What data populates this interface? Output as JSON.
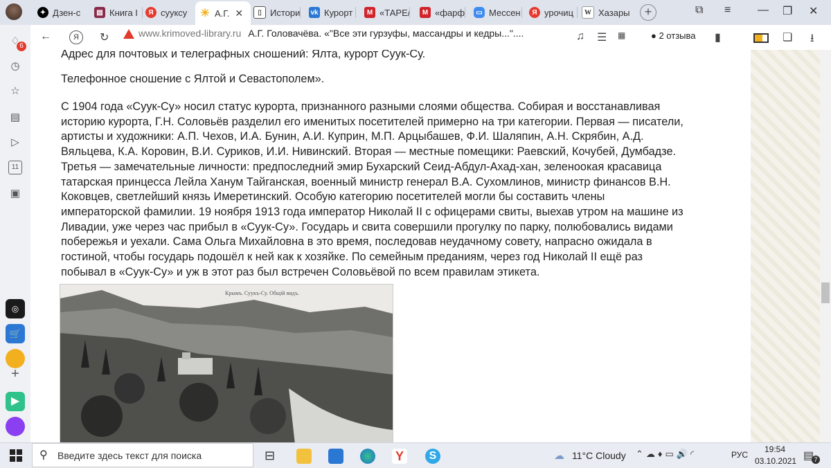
{
  "tabs": [
    {
      "label": "Дзен-с",
      "color": "#000"
    },
    {
      "label": "Книга I",
      "color": "#8a2a4a"
    },
    {
      "label": "суукcу",
      "color": "#e63a2e"
    },
    {
      "label": "А.Г.",
      "color": "#f2b01e"
    },
    {
      "label": "Истори",
      "color": "#444"
    },
    {
      "label": "Курорт",
      "color": "#2a77d4"
    },
    {
      "label": "«ТАРЕ/",
      "color": "#d0232a"
    },
    {
      "label": "«фарф",
      "color": "#d0232a"
    },
    {
      "label": "Мессен",
      "color": "#3f8cf0"
    },
    {
      "label": "урочиц",
      "color": "#e63a2e"
    },
    {
      "label": "Хазары",
      "color": "#555"
    }
  ],
  "address": {
    "domain": "www.krimoved-library.ru",
    "title": "А.Г. Головачёва. «\"Все эти гурзуфы, массандры и кедры...\"....",
    "reviews": "2 отзыва"
  },
  "article": {
    "line0": "Адрес для почтовых и телеграфных сношений: Ялта, курорт Суук-Су.",
    "p1": "Телефонное сношение с Ялтой и Севастополем».",
    "p2": [
      "С 1904 года «Суук-Су» носил статус курорта, признанного разными слоями общества. Собирая и восстанавливая",
      "историю курорта, Г.Н. Соловьёв разделил его именитых посетителей примерно на три категории. Первая — писатели,",
      "артисты и художники: А.П. Чехов, И.А. Бунин, А.И. Куприн, М.П. Арцыбашев, Ф.И. Шаляпин, А.Н. Скрябин, А.Д.",
      "Вяльцева, К.А. Коровин, В.И. Суриков, И.И. Нивинский. Вторая — местные помещики: Раевский, Кочубей, Думбадзе.",
      "Третья — замечательные личности: предпоследний эмир Бухарский Сеид-Абдул-Ахад-хан, зеленоокая красавица",
      "татарская принцесса Лейла Ханум Тайганская, военный министр генерал В.А. Сухомлинов, министр финансов В.Н.",
      "Коковцев, светлейший князь Имеретинский. Особую категорию посетителей могли бы составить члены",
      "императорской фамилии. 19 ноября 1913 года император Николай II с офицерами свиты, выехав утром на машине из",
      "Ливадии, уже через час прибыл в «Суук-Су». Государь и свита совершили прогулку по парку, полюбовались видами",
      "побережья и уехали. Сама Ольга Михайловна в это время, последовав неудачному совету, напрасно ожидала в",
      "гостиной, чтобы государь подошёл к ней как к хозяйке. По семейным преданиям, через год Николай II ещё раз",
      "побывал в «Суук-Су» и уж в этот раз был встречен Соловьёвой по всем правилам этикета."
    ],
    "photo_caption": "Крымъ.   Суукъ-Су. Общiй видъ."
  },
  "sidebar_badges": {
    "notifications": "6",
    "counter": "11"
  },
  "taskbar": {
    "search_placeholder": "Введите здесь текст для поиска",
    "weather": "11°C  Cloudy",
    "lang": "РУС",
    "time": "19:54",
    "date": "03.10.2021",
    "notif_count": "7"
  }
}
